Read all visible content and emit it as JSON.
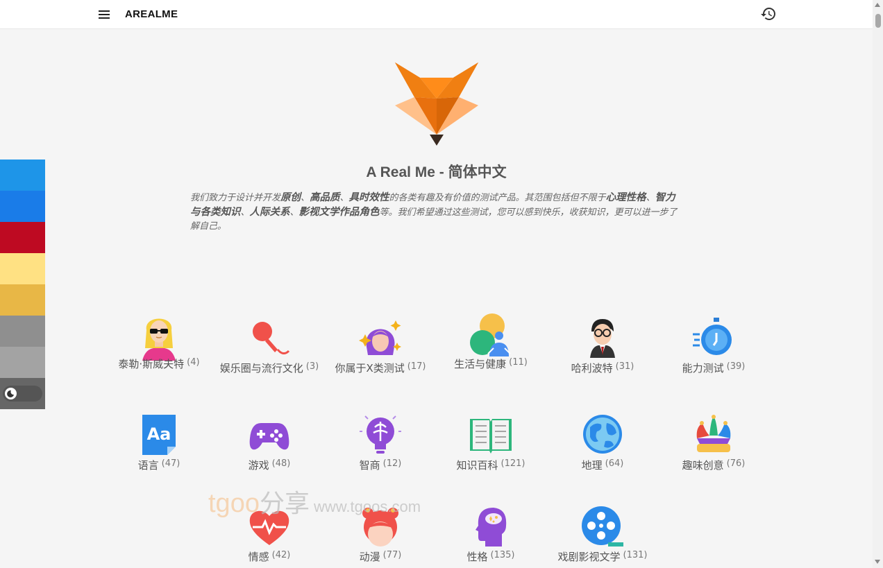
{
  "header": {
    "brand": "AREALME"
  },
  "theme_swatches": [
    "#1e95e8",
    "#1a7ce8",
    "#be0a22",
    "#ffe183",
    "#e8b746",
    "#8f8f8f",
    "#a3a3a3"
  ],
  "hero": {
    "title": "A Real Me - 简体中文",
    "desc": [
      {
        "t": "我们致力于设计并开发",
        "b": false
      },
      {
        "t": "原创",
        "b": true
      },
      {
        "t": "、",
        "b": false
      },
      {
        "t": "高品质",
        "b": true
      },
      {
        "t": "、",
        "b": false
      },
      {
        "t": "具时效性",
        "b": true
      },
      {
        "t": "的各类有趣及有价值的测试产品。其范围包括但不限于",
        "b": false
      },
      {
        "t": "心理性格",
        "b": true
      },
      {
        "t": "、",
        "b": false
      },
      {
        "t": "智力与各类知识",
        "b": true
      },
      {
        "t": "、",
        "b": false
      },
      {
        "t": "人际关系",
        "b": true
      },
      {
        "t": "、",
        "b": false
      },
      {
        "t": "影视文学作品角色",
        "b": true
      },
      {
        "t": "等。我们希望通过这些测试，您可以感到快乐，收获知识，更可以进一步了解自己。",
        "b": false
      }
    ]
  },
  "categories": [
    {
      "label": "泰勒·斯威夫特",
      "count": "(4)",
      "icon": "taylor-swift-icon"
    },
    {
      "label": "娱乐圈与流行文化",
      "count": "(3)",
      "icon": "microphone-icon"
    },
    {
      "label": "你属于X类测试",
      "count": "(17)",
      "icon": "sparkle-girl-icon"
    },
    {
      "label": "生活与健康",
      "count": "(11)",
      "icon": "lifestyle-icon"
    },
    {
      "label": "哈利波特",
      "count": "(31)",
      "icon": "harry-potter-icon"
    },
    {
      "label": "能力测试",
      "count": "(39)",
      "icon": "stopwatch-icon"
    },
    {
      "label": "语言",
      "count": "(47)",
      "icon": "language-icon"
    },
    {
      "label": "游戏",
      "count": "(48)",
      "icon": "gamepad-icon"
    },
    {
      "label": "智商",
      "count": "(12)",
      "icon": "brain-bulb-icon"
    },
    {
      "label": "知识百科",
      "count": "(121)",
      "icon": "book-icon"
    },
    {
      "label": "地理",
      "count": "(64)",
      "icon": "globe-icon"
    },
    {
      "label": "趣味创意",
      "count": "(76)",
      "icon": "jester-hat-icon"
    },
    {
      "label": "情感",
      "count": "(42)",
      "icon": "heart-pulse-icon"
    },
    {
      "label": "动漫",
      "count": "(77)",
      "icon": "anime-girl-icon"
    },
    {
      "label": "性格",
      "count": "(135)",
      "icon": "personality-head-icon"
    },
    {
      "label": "戏剧影视文学",
      "count": "(131)",
      "icon": "film-reel-icon"
    }
  ],
  "watermark": {
    "brand_en": "tgoo",
    "brand_cn": "分享",
    "url": "www.tgoos.com"
  }
}
